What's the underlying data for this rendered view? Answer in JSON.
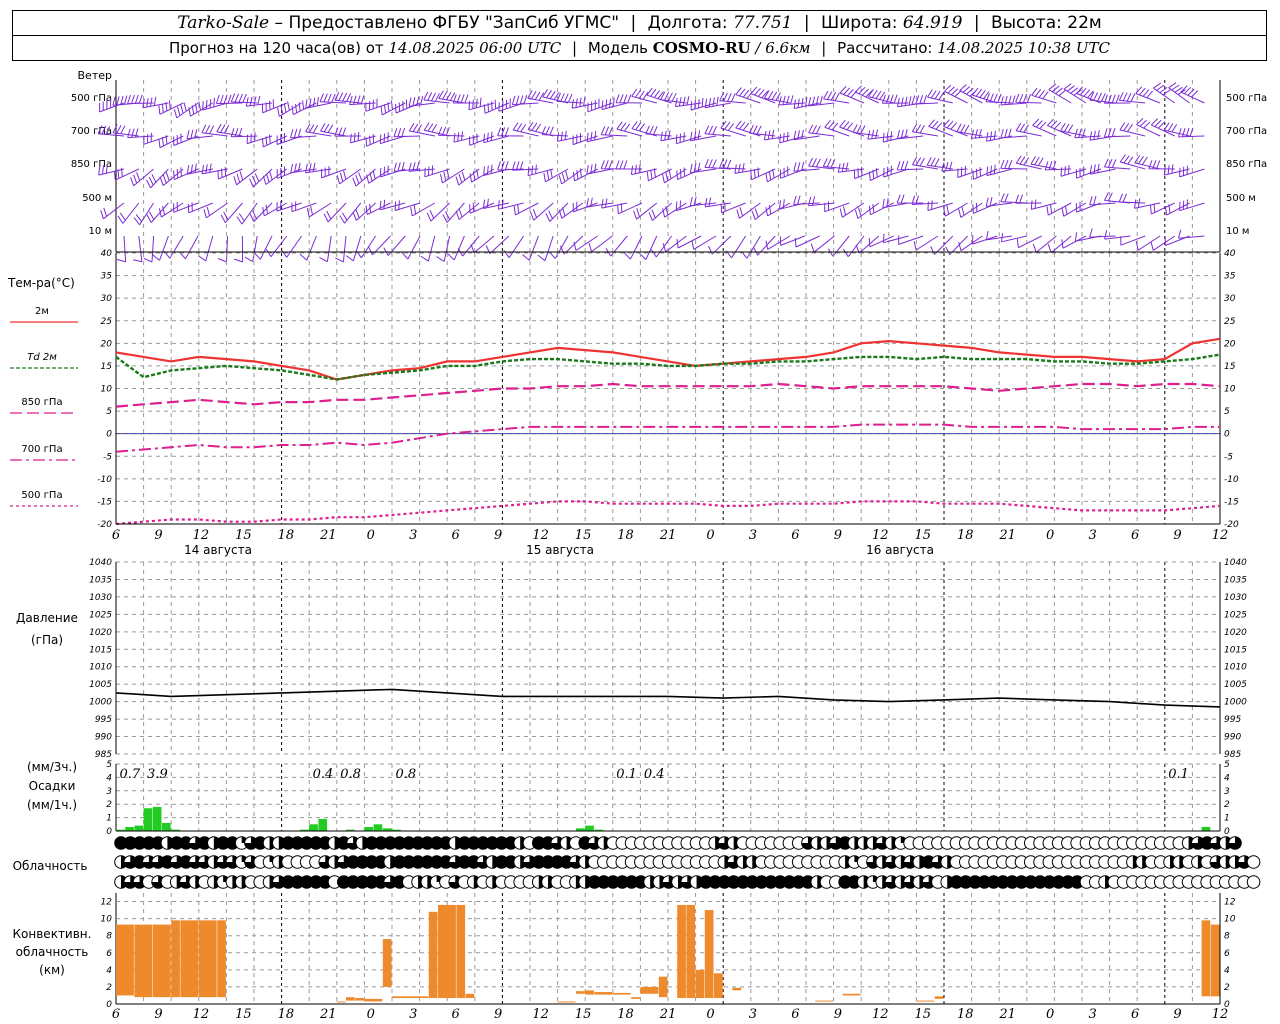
{
  "header": {
    "station": "Tarko-Sale",
    "dash": "–",
    "provider": "Предоставлено ФГБУ \"ЗапСиб УГМС\"",
    "lon_label": "Долгота:",
    "lon_value": "77.751",
    "lat_label": "Широта:",
    "lat_value": "64.919",
    "alt_label": "Высота:",
    "alt_value": "22м",
    "forecast_prefix": "Прогноз на 120 часа(ов) от",
    "forecast_start": "14.08.2025 06:00 UTC",
    "model_label": "Модель",
    "model_name": "COSMO-RU",
    "model_res": "/ 6.6км",
    "calc_label": "Рассчитано:",
    "calc_time": "14.08.2025 10:38 UTC"
  },
  "colors": {
    "wind": "#7b2bd4",
    "t2m": "#ee3333",
    "td2m": "#1a7a1a",
    "t850": "#dd1f8f",
    "t700": "#dd1f8f",
    "t500": "#dd1f8f",
    "pressure": "#000000",
    "precip": "#22cc22",
    "convective": "#ee8a2c",
    "grid": "#9a9a9a"
  },
  "chart_data": [
    {
      "type": "wind_barbs",
      "title": "Ветер",
      "levels": [
        "500 гПа",
        "700 гПа",
        "850 гПа",
        "500 м",
        "10 м"
      ],
      "directions_deg": [
        [
          250,
          290
        ],
        [
          260,
          280
        ],
        [
          240,
          270
        ],
        [
          230,
          260
        ],
        [
          190,
          255
        ]
      ],
      "speeds_kn": [
        [
          35,
          40
        ],
        [
          30,
          35
        ],
        [
          25,
          30
        ],
        [
          15,
          25
        ],
        [
          8,
          12
        ]
      ]
    },
    {
      "type": "line",
      "ylabel": "Тем-ра(°C)",
      "ylim": [
        -20,
        40
      ],
      "yticks": [
        40,
        35,
        30,
        25,
        20,
        15,
        10,
        5,
        0,
        -5,
        -10,
        -15,
        -20
      ],
      "x_hours": [
        0,
        3,
        6,
        9,
        12,
        15,
        18,
        21,
        24,
        27,
        30,
        33,
        36,
        39,
        42,
        45,
        48,
        51,
        54,
        57,
        60,
        63,
        66,
        69,
        72,
        75,
        78,
        81,
        84,
        87,
        90,
        93,
        96,
        99,
        102,
        105,
        108,
        111,
        114,
        117,
        120
      ],
      "series": [
        {
          "name": "2м",
          "values": [
            18,
            17,
            16,
            17,
            16.5,
            16,
            15,
            14,
            12,
            13,
            14,
            14.5,
            16,
            16,
            17,
            18,
            19,
            18.5,
            18,
            17,
            16,
            15,
            15.5,
            16,
            16.5,
            17,
            18,
            20,
            20.5,
            20,
            19.5,
            19,
            18,
            17.5,
            17,
            17,
            16.5,
            16,
            16.5,
            20,
            21
          ]
        },
        {
          "name": "Td 2м",
          "values": [
            17,
            12.5,
            14,
            14.5,
            15,
            14.5,
            14,
            13,
            12,
            13,
            13.5,
            14,
            15,
            15,
            16,
            16.5,
            16.5,
            16,
            15.5,
            15.5,
            15,
            15,
            15.5,
            15.5,
            16,
            16,
            16.5,
            17,
            17,
            16.5,
            17,
            16.5,
            16.5,
            16.5,
            16,
            16,
            15.5,
            15.5,
            16,
            16.5,
            17.5
          ]
        },
        {
          "name": "850 гПа",
          "values": [
            6,
            6.5,
            7,
            7.5,
            7,
            6.5,
            7,
            7,
            7.5,
            7.5,
            8,
            8.5,
            9,
            9.5,
            10,
            10,
            10.5,
            10.5,
            11,
            10.5,
            10.5,
            10.5,
            10.5,
            10.5,
            11,
            10.5,
            10,
            10.5,
            10.5,
            10.5,
            10.5,
            10,
            9.5,
            10,
            10.5,
            11,
            11,
            10.5,
            11,
            11,
            10.5
          ]
        },
        {
          "name": "700 гПа",
          "values": [
            -4,
            -3.5,
            -3,
            -2.5,
            -3,
            -3,
            -2.5,
            -2.5,
            -2,
            -2.5,
            -2,
            -1,
            0,
            0.5,
            1,
            1.5,
            1.5,
            1.5,
            1.5,
            1.5,
            1.5,
            1.5,
            1.5,
            1.5,
            1.5,
            1.5,
            1.5,
            2,
            2,
            2,
            2,
            1.5,
            1.5,
            1.5,
            1.5,
            1,
            1,
            1,
            1,
            1.5,
            1.5
          ]
        },
        {
          "name": "500 гПа",
          "values": [
            -20,
            -19.5,
            -19,
            -19,
            -19.5,
            -19.5,
            -19,
            -19,
            -18.5,
            -18.5,
            -18,
            -17.5,
            -17,
            -16.5,
            -16,
            -15.5,
            -15,
            -15,
            -15.5,
            -15.5,
            -15.5,
            -15.5,
            -16,
            -16,
            -15.5,
            -15.5,
            -15.5,
            -15,
            -15,
            -15,
            -15.5,
            -15.5,
            -15.5,
            -16,
            -16.5,
            -17,
            -17,
            -17,
            -17,
            -16.5,
            -16
          ]
        }
      ]
    },
    {
      "type": "line",
      "ylabel": "Давление",
      "yunit": "(гПа)",
      "ylim": [
        985,
        1040
      ],
      "yticks": [
        1040,
        1035,
        1030,
        1025,
        1020,
        1015,
        1010,
        1005,
        1000,
        995,
        990,
        985
      ],
      "x_hours": [
        0,
        6,
        12,
        18,
        24,
        30,
        36,
        42,
        48,
        54,
        60,
        66,
        72,
        78,
        84,
        90,
        96,
        102,
        108,
        114,
        120
      ],
      "series": [
        {
          "name": "Давление",
          "values": [
            1002.5,
            1001.5,
            1002,
            1002.5,
            1003,
            1003.5,
            1002.5,
            1001.5,
            1001.5,
            1001.5,
            1001.5,
            1001,
            1001.5,
            1000.5,
            1000,
            1000.5,
            1001,
            1000.5,
            1000,
            999,
            998.5
          ]
        }
      ],
      "xticks": [
        "6",
        "9",
        "12",
        "15",
        "18",
        "21",
        "0",
        "3",
        "6",
        "9",
        "12",
        "15",
        "18",
        "21",
        "0",
        "3",
        "6",
        "9",
        "12",
        "15",
        "18",
        "21",
        "0",
        "3",
        "6",
        "9",
        "12"
      ],
      "day_labels": [
        "14 августа",
        "15 августа",
        "16 августа"
      ]
    },
    {
      "type": "bar",
      "ylabel_top": "(мм/3ч.)",
      "ylabel": "Осадки",
      "ylabel_bottom": "(мм/1ч.)",
      "ylim": [
        0,
        5
      ],
      "yticks": [
        5,
        4,
        3,
        2,
        1,
        0
      ],
      "x_hours": [
        1,
        2,
        3,
        4,
        5,
        6,
        7,
        21,
        22,
        23,
        26,
        28,
        29,
        30,
        31,
        51,
        52,
        53,
        119
      ],
      "values": [
        0.1,
        0.3,
        0.4,
        1.7,
        1.8,
        0.6,
        0.1,
        0.1,
        0.5,
        0.9,
        0.1,
        0.3,
        0.5,
        0.2,
        0.1,
        0.2,
        0.4,
        0.1,
        0.3
      ],
      "totals_3h": [
        {
          "hour": 1.5,
          "label": "0.7"
        },
        {
          "hour": 4.5,
          "label": "3.9"
        },
        {
          "hour": 22.5,
          "label": "0.4"
        },
        {
          "hour": 25.5,
          "label": "0.8"
        },
        {
          "hour": 31.5,
          "label": "0.8"
        },
        {
          "hour": 55.5,
          "label": "0.1"
        },
        {
          "hour": 58.5,
          "label": "0.4"
        },
        {
          "hour": 115.5,
          "label": "0.1"
        }
      ]
    },
    {
      "type": "cloud_symbols",
      "title": "Облачность",
      "rows": 3,
      "hours_per_symbol": 1,
      "start_hour": 0,
      "row_values": [
        [
          1,
          1,
          1,
          1,
          1,
          0.5,
          1,
          1,
          0.75,
          1,
          0.5,
          1,
          1,
          0.25,
          0.75,
          1,
          0.5,
          0.5,
          1,
          1,
          1,
          1,
          1,
          0.5,
          1,
          0.75,
          0.5,
          1,
          1,
          1,
          1,
          1,
          1,
          1,
          1,
          1,
          0.5,
          1,
          1,
          1,
          1,
          1,
          1,
          0.5,
          0,
          1,
          1,
          0.75,
          0.5,
          0,
          1,
          0.75,
          0.5,
          0,
          0,
          0,
          0,
          0,
          0,
          0,
          0,
          0,
          0,
          0,
          0.5,
          0.75,
          0.5,
          0,
          0,
          0,
          0,
          0,
          0,
          0,
          0.75,
          0.5,
          0.5,
          0.75,
          1,
          0.5,
          0.5,
          0.5,
          0.75,
          0.5,
          0.25,
          0,
          0,
          0,
          0,
          0,
          0,
          0,
          0,
          0,
          0,
          0,
          0,
          0,
          0,
          0,
          0,
          0,
          0,
          0,
          0,
          0,
          0,
          0,
          0,
          0,
          0,
          0,
          0,
          0,
          0,
          0.5,
          0.75,
          1,
          0.75,
          0.5,
          0.75
        ],
        [
          0.5,
          0.75,
          1,
          0.75,
          0.75,
          1,
          0.75,
          1,
          0.75,
          0.75,
          0.5,
          0.75,
          0.75,
          0.25,
          0.75,
          0,
          0.25,
          0.5,
          0,
          0,
          0,
          0,
          0.75,
          0.5,
          0.75,
          1,
          1,
          1,
          1,
          0.5,
          1,
          1,
          1,
          1,
          1,
          1,
          0.75,
          1,
          1,
          0.75,
          0.5,
          1,
          1,
          0.5,
          0.75,
          1,
          1,
          1,
          1,
          0.75,
          0.5,
          0,
          0,
          0,
          0,
          0,
          0,
          0,
          0,
          0,
          0,
          0,
          0,
          0,
          0,
          0.5,
          0.75,
          0.5,
          0.5,
          0,
          0,
          0,
          0,
          0,
          0,
          0,
          0,
          0,
          0.5,
          0.25,
          0,
          0.75,
          0.5,
          0.75,
          0.5,
          0.75,
          0.5,
          1,
          0.75,
          0.5,
          0,
          0,
          0,
          0,
          0,
          0,
          0,
          0,
          0,
          0,
          0,
          0,
          0,
          0,
          0,
          0,
          0,
          0,
          0,
          0.5,
          0.5,
          0,
          0,
          0.5,
          0.5,
          0,
          0.5,
          0,
          0.75,
          0.5,
          0.5,
          0.75,
          0
        ],
        [
          0.5,
          0.75,
          0.75,
          0,
          0.75,
          0,
          0.5,
          0.75,
          0.5,
          0,
          0.5,
          0.25,
          0.5,
          0.5,
          0,
          0,
          0.5,
          0.75,
          1,
          1,
          1,
          1,
          1,
          0,
          1,
          1,
          1,
          1,
          1,
          0.75,
          1,
          0,
          0.5,
          0.5,
          0.25,
          0,
          0.75,
          0,
          0.5,
          0,
          0.5,
          0,
          0,
          0,
          0,
          0.5,
          0.5,
          0,
          0,
          0.5,
          0.5,
          1,
          1,
          1,
          1,
          1,
          1,
          0.5,
          0.5,
          0.75,
          0.5,
          0.75,
          0.5,
          1,
          1,
          1,
          1,
          1,
          1,
          1,
          1,
          1,
          1,
          1,
          1,
          0.5,
          0,
          0,
          1,
          1,
          0.5,
          0.25,
          0.5,
          0.75,
          0.5,
          0.75,
          0.5,
          0.75,
          0,
          0.5,
          1,
          1,
          1,
          1,
          1,
          1,
          1,
          1,
          1,
          1,
          1,
          1,
          1,
          1,
          0,
          0,
          0.5,
          0,
          0,
          0,
          0,
          0,
          0,
          0,
          0,
          0,
          0,
          0,
          0,
          0,
          0,
          0,
          0
        ]
      ]
    },
    {
      "type": "range_bar",
      "ylabel_lines": [
        "Конвективн.",
        "облачность",
        "(км)"
      ],
      "ylim": [
        0,
        13
      ],
      "yticks": [
        12,
        10,
        8,
        6,
        4,
        2,
        0
      ],
      "bars": [
        {
          "from_h": 0,
          "to_h": 2,
          "base": 1,
          "top": 9.3
        },
        {
          "from_h": 2,
          "to_h": 4,
          "base": 0.8,
          "top": 9.3
        },
        {
          "from_h": 4,
          "to_h": 6,
          "base": 0.8,
          "top": 9.3
        },
        {
          "from_h": 6,
          "to_h": 7,
          "base": 0.8,
          "top": 9.8
        },
        {
          "from_h": 7,
          "to_h": 9,
          "base": 0.8,
          "top": 9.8
        },
        {
          "from_h": 9,
          "to_h": 11,
          "base": 0.8,
          "top": 9.8
        },
        {
          "from_h": 11,
          "to_h": 12,
          "base": 0.8,
          "top": 9.8
        },
        {
          "from_h": 24,
          "to_h": 25,
          "base": 0.2,
          "top": 0.3
        },
        {
          "from_h": 25,
          "to_h": 26,
          "base": 0.4,
          "top": 0.8
        },
        {
          "from_h": 26,
          "to_h": 27,
          "base": 0.4,
          "top": 0.7
        },
        {
          "from_h": 27,
          "to_h": 29,
          "base": 0.3,
          "top": 0.6
        },
        {
          "from_h": 29,
          "to_h": 30,
          "base": 2,
          "top": 7.6
        },
        {
          "from_h": 30,
          "to_h": 34,
          "base": 0.7,
          "top": 0.9
        },
        {
          "from_h": 34,
          "to_h": 35,
          "base": 0.7,
          "top": 10.8
        },
        {
          "from_h": 35,
          "to_h": 37,
          "base": 0.7,
          "top": 11.6
        },
        {
          "from_h": 37,
          "to_h": 38,
          "base": 0.7,
          "top": 11.6
        },
        {
          "from_h": 38,
          "to_h": 39,
          "base": 0.7,
          "top": 1.2
        },
        {
          "from_h": 48,
          "to_h": 50,
          "base": 0.2,
          "top": 0.3
        },
        {
          "from_h": 50,
          "to_h": 51,
          "base": 1.2,
          "top": 1.5
        },
        {
          "from_h": 51,
          "to_h": 52,
          "base": 1.1,
          "top": 1.6
        },
        {
          "from_h": 52,
          "to_h": 54,
          "base": 1.1,
          "top": 1.4
        },
        {
          "from_h": 54,
          "to_h": 56,
          "base": 1.1,
          "top": 1.3
        },
        {
          "from_h": 56,
          "to_h": 57,
          "base": 0.6,
          "top": 0.8
        },
        {
          "from_h": 57,
          "to_h": 59,
          "base": 1.2,
          "top": 2
        },
        {
          "from_h": 59,
          "to_h": 60,
          "base": 0.8,
          "top": 3.2
        },
        {
          "from_h": 61,
          "to_h": 62,
          "base": 0.7,
          "top": 11.6
        },
        {
          "from_h": 62,
          "to_h": 63,
          "base": 0.7,
          "top": 11.6
        },
        {
          "from_h": 63,
          "to_h": 64,
          "base": 0.7,
          "top": 4
        },
        {
          "from_h": 64,
          "to_h": 65,
          "base": 0.7,
          "top": 11
        },
        {
          "from_h": 65,
          "to_h": 66,
          "base": 0.7,
          "top": 3.6
        },
        {
          "from_h": 67,
          "to_h": 68,
          "base": 1.6,
          "top": 1.9
        },
        {
          "from_h": 76,
          "to_h": 78,
          "base": 0.3,
          "top": 0.4
        },
        {
          "from_h": 79,
          "to_h": 81,
          "base": 1,
          "top": 1.2
        },
        {
          "from_h": 87,
          "to_h": 89,
          "base": 0.3,
          "top": 0.4
        },
        {
          "from_h": 89,
          "to_h": 90,
          "base": 0.6,
          "top": 0.9
        },
        {
          "from_h": 118,
          "to_h": 119,
          "base": 0.9,
          "top": 9.8
        },
        {
          "from_h": 119,
          "to_h": 120,
          "base": 0.9,
          "top": 9.3
        }
      ]
    }
  ]
}
